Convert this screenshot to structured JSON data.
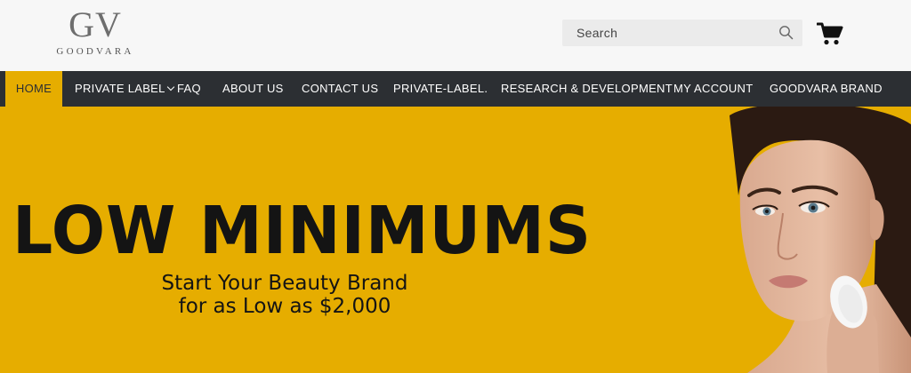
{
  "brand": {
    "logo_mark": "GV",
    "logo_word": "GOODVARA"
  },
  "search": {
    "placeholder": "Search",
    "icon": "search-icon"
  },
  "cart": {
    "icon": "cart-icon"
  },
  "nav": {
    "items": [
      {
        "label": "HOME",
        "active": true
      },
      {
        "label": "PRIVATE LABEL",
        "has_dropdown": true
      },
      {
        "label": "FAQ"
      },
      {
        "label": "ABOUT US"
      },
      {
        "label": "CONTACT US"
      },
      {
        "label": "PRIVATE-LABEL."
      },
      {
        "label": "RESEARCH & DEVELOPMENT"
      },
      {
        "label": "MY ACCOUNT"
      },
      {
        "label": "GOODVARA BRAND"
      }
    ]
  },
  "hero": {
    "headline": "LOW MINIMUMS",
    "subline_1": "Start Your Beauty Brand",
    "subline_2": "for as Low as $2,000"
  },
  "colors": {
    "accent": "#e6ad00",
    "nav_bg": "#2c2f33",
    "topbar_bg": "#f7f7f7",
    "text_dark": "#141414"
  }
}
